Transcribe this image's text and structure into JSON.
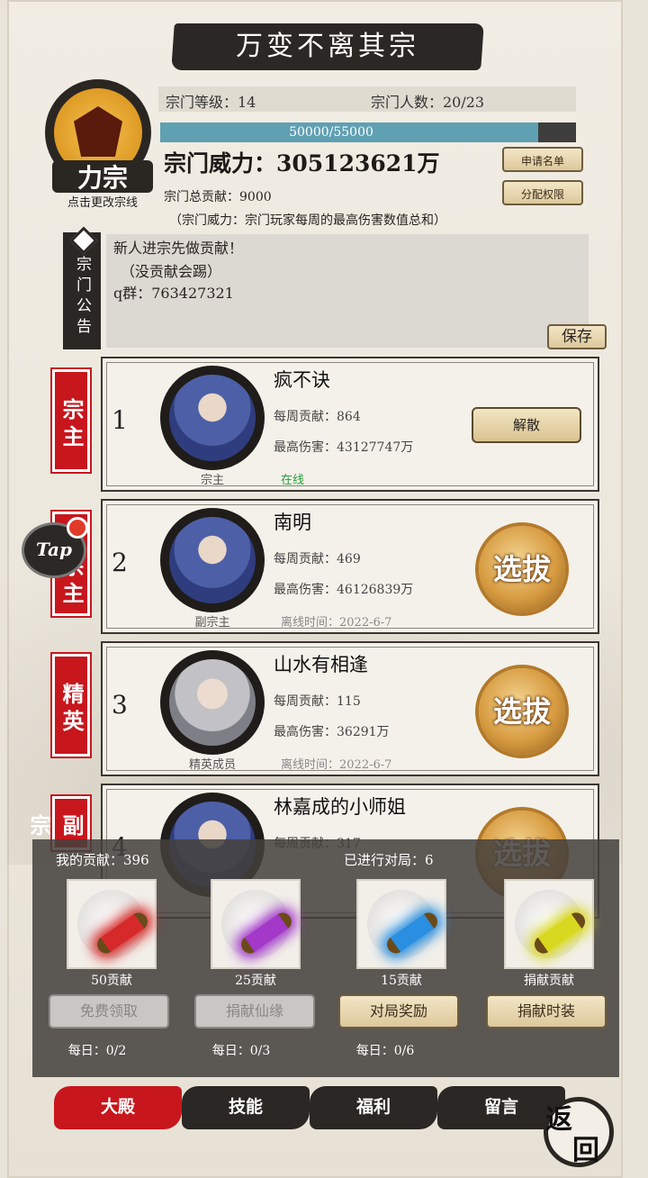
{
  "title": "万变不离其宗",
  "sect": {
    "name": "力宗",
    "hint": "点击更改宗线"
  },
  "info": {
    "level": "宗门等级：14",
    "members": "宗门人数：20/23",
    "progress_text": "50000/55000",
    "progress": 0.909,
    "power": "宗门威力：305123621万",
    "total_contrib": "宗门总贡献：9000",
    "note": "（宗门威力：宗门玩家每周的最高伤害数值总和）",
    "apply_btn": "申请名单",
    "assign_btn": "分配权限"
  },
  "notice": {
    "tag": "宗门公告",
    "lines": [
      "新人进宗先做贡献！",
      "（没贡献会踢）",
      "q群：763427321"
    ],
    "save": "保存"
  },
  "rank_tags": [
    "宗主",
    "副宗主",
    "精英",
    "副宗"
  ],
  "tap": "Tap",
  "members": [
    {
      "rank": "1",
      "name": "疯不诀",
      "role": "宗主",
      "weekly": "每周贡献：864",
      "max": "最高伤害：43127747万",
      "status": "在线",
      "action": "解散"
    },
    {
      "rank": "2",
      "name": "南明",
      "role": "副宗主",
      "weekly": "每周贡献：469",
      "max": "最高伤害：46126839万",
      "status": "离线时间：2022-6-7",
      "action": "选拔"
    },
    {
      "rank": "3",
      "name": "山水有相逢",
      "role": "精英成员",
      "weekly": "每周贡献：115",
      "max": "最高伤害：36291万",
      "status": "离线时间：2022-6-7",
      "action": "选拔"
    },
    {
      "rank": "4",
      "name": "林嘉成的小师姐",
      "role": "",
      "weekly": "每周贡献：317",
      "max": "",
      "status": "",
      "action": "选拔"
    }
  ],
  "panel": {
    "my_contrib": "我的贡献：396",
    "played": "已进行对局：6",
    "items": [
      {
        "label": "50贡献",
        "color": "#d62a2a",
        "button": "免费领取",
        "enabled": false,
        "daily": "每日：0/2"
      },
      {
        "label": "25贡献",
        "color": "#a338c9",
        "button": "捐献仙缘",
        "enabled": false,
        "daily": "每日：0/3"
      },
      {
        "label": "15贡献",
        "color": "#2a8fe0",
        "button": "对局奖励",
        "enabled": true,
        "daily": "每日：0/6"
      },
      {
        "label": "捐献贡献",
        "color": "#d8d820",
        "button": "捐献时装",
        "enabled": true,
        "daily": ""
      }
    ]
  },
  "nav": [
    "大殿",
    "技能",
    "福利",
    "留言"
  ],
  "back": [
    "返",
    "回"
  ]
}
